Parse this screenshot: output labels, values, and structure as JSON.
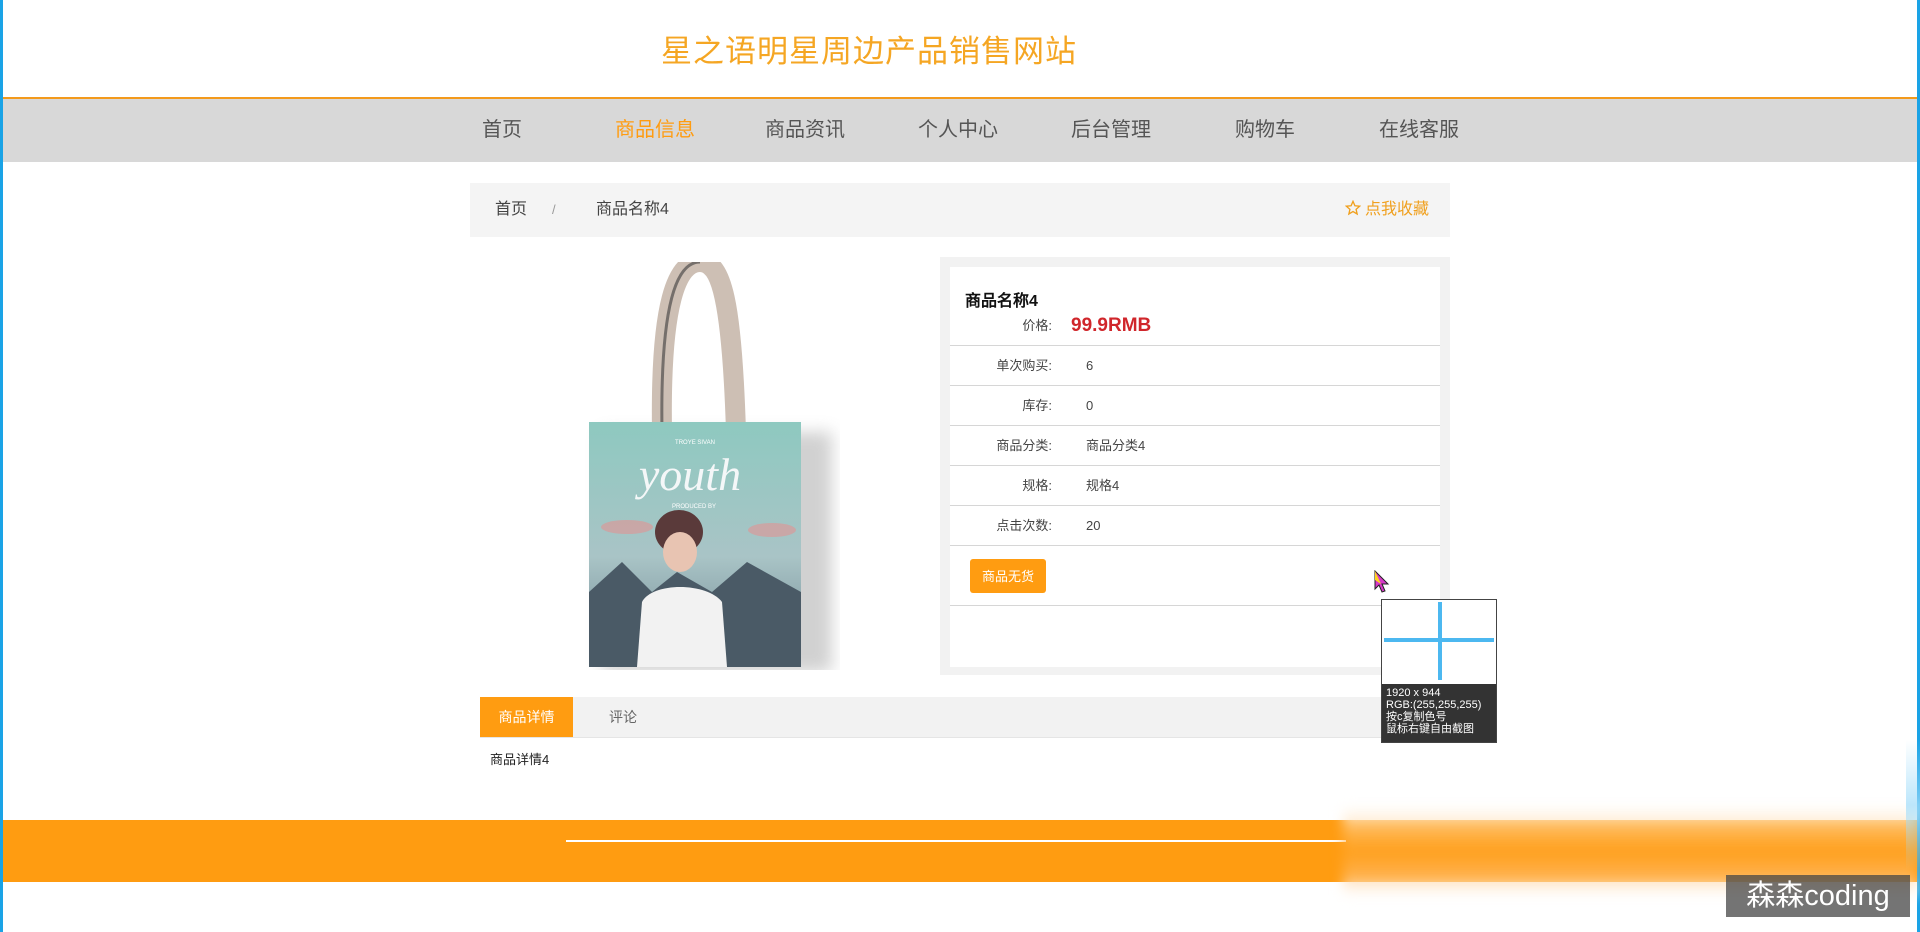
{
  "site": {
    "title": "星之语明星周边产品销售网站"
  },
  "nav": {
    "items": [
      "首页",
      "商品信息",
      "商品资讯",
      "个人中心",
      "后台管理",
      "购物车",
      "在线客服"
    ],
    "active_index": 1
  },
  "breadcrumb": {
    "home": "首页",
    "separator": "/",
    "current": "商品名称4",
    "favorite": "点我收藏"
  },
  "product": {
    "image_icon": "tote-bag-image",
    "name": "商品名称4",
    "fields": [
      {
        "label": "价格:",
        "value": "99.9RMB",
        "kind": "price"
      },
      {
        "label": "单次购买:",
        "value": "6"
      },
      {
        "label": "库存:",
        "value": "0"
      },
      {
        "label": "商品分类:",
        "value": "商品分类4"
      },
      {
        "label": "规格:",
        "value": "规格4"
      },
      {
        "label": "点击次数:",
        "value": "20"
      }
    ],
    "sold_out_button": "商品无货"
  },
  "tabs": {
    "items": [
      "商品详情",
      "评论"
    ],
    "active_index": 0
  },
  "detail": {
    "text": "商品详情4"
  },
  "picker": {
    "size": "1920 x 944",
    "rgb": "RGB:(255,255,255)",
    "hint1": "按c复制色号",
    "hint2": "鼠标右键自由截图"
  },
  "watermark": "森森coding",
  "colors": {
    "accent": "#ff9c11",
    "price": "#d0262b",
    "nav_bg": "#d8d8d8",
    "title": "#f5a623"
  }
}
